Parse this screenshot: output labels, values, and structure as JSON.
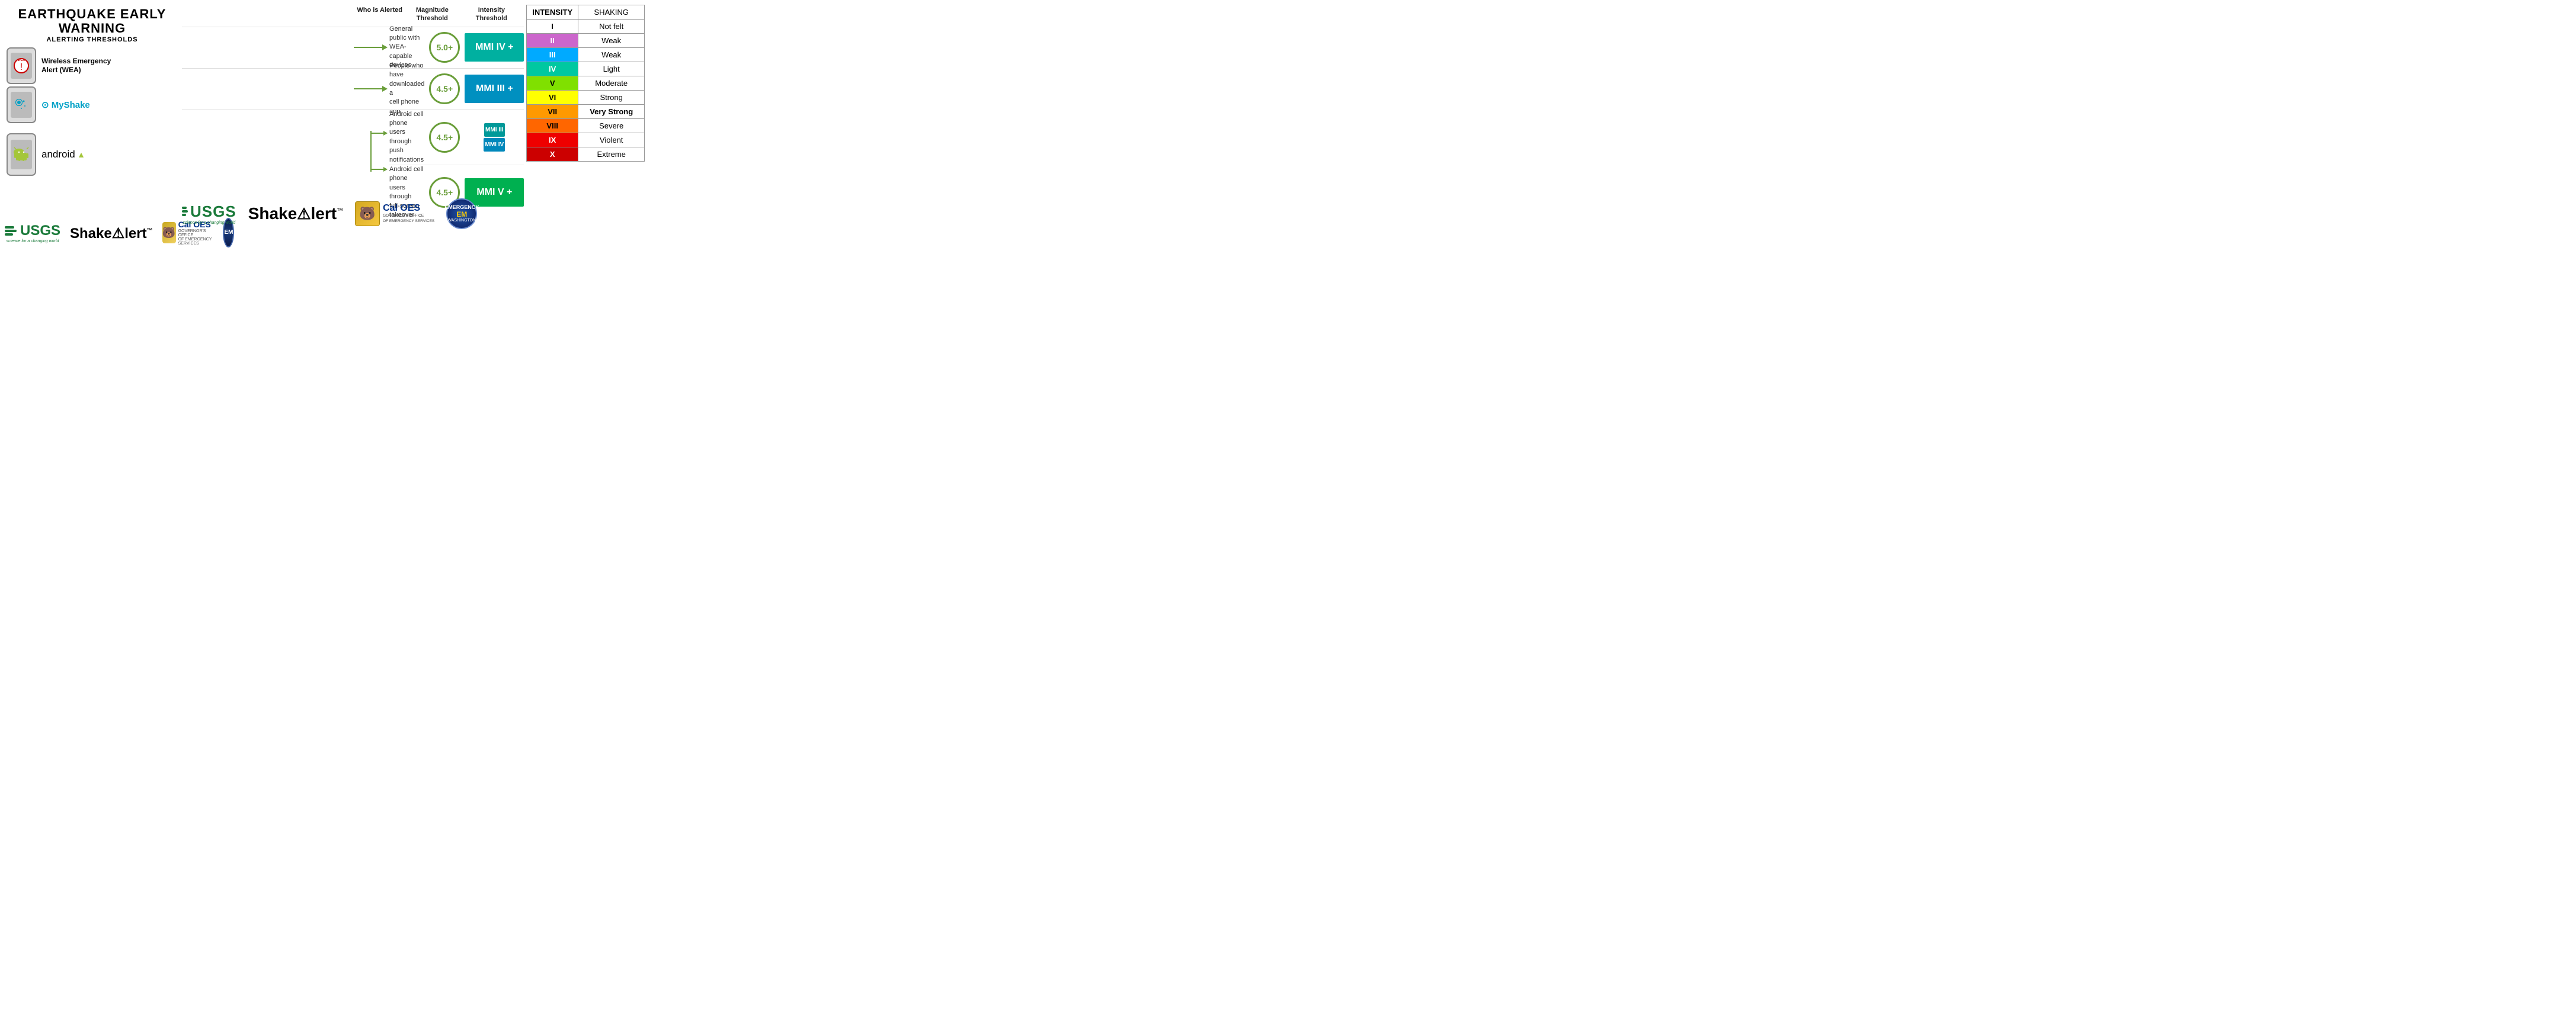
{
  "title": {
    "main": "EARTHQUAKE EARLY WARNING",
    "sub": "ALERTING THRESHOLDS"
  },
  "columns": {
    "who": "Who is Alerted",
    "magnitude": "Magnitude\nThreshold",
    "intensity": "Intensity\nThreshold"
  },
  "alerts": [
    {
      "id": "wea",
      "label": "Wireless Emergency\nAlert (WEA)",
      "who": "General public with WEA-capable devices",
      "magnitude": "5.0+",
      "intensity": "MMI IV +",
      "intensity_color": "teal"
    },
    {
      "id": "myshake",
      "label": "MyShake",
      "who": "People who have downloaded a cell phone app",
      "magnitude": "4.5+",
      "intensity": "MMI III +",
      "intensity_color": "blue"
    },
    {
      "id": "android",
      "label": "android",
      "rows": [
        {
          "who": "Android cell phone users through push notifications",
          "magnitude": "4.5+",
          "intensity_top": "MMI III",
          "intensity_bottom": "MMI IV",
          "intensity_type": "split"
        },
        {
          "who": "Android cell phone users through full-screen takeover",
          "magnitude": "4.5+",
          "intensity": "MMI V +",
          "intensity_color": "green"
        }
      ]
    }
  ],
  "table": {
    "headers": [
      "INTENSITY",
      "SHAKING"
    ],
    "rows": [
      {
        "intensity": "I",
        "shaking": "Not felt",
        "bg": "white"
      },
      {
        "intensity": "II",
        "shaking": "Weak",
        "bg": "purple"
      },
      {
        "intensity": "III",
        "shaking": "Weak",
        "bg": "blue"
      },
      {
        "intensity": "IV",
        "shaking": "Light",
        "bg": "teal"
      },
      {
        "intensity": "V",
        "shaking": "Moderate",
        "bg": "lgreen"
      },
      {
        "intensity": "VI",
        "shaking": "Strong",
        "bg": "yellow"
      },
      {
        "intensity": "VII",
        "shaking": "Very Strong",
        "bg": "orange"
      },
      {
        "intensity": "VIII",
        "shaking": "Severe",
        "bg": "darkorange"
      },
      {
        "intensity": "IX",
        "shaking": "Violent",
        "bg": "red"
      },
      {
        "intensity": "X",
        "shaking": "Extreme",
        "bg": "darkred"
      }
    ]
  },
  "logos": {
    "usgs": "≡USGS",
    "usgs_sub": "science for a changing world",
    "shakealert": "ShakeAlert",
    "tm": "™",
    "caloes": "Cal OES",
    "caloes_gov": "GOVERNOR'S OFFICE\nOF EMERGENCY SERVICES",
    "em": "EM"
  },
  "colors": {
    "teal": "#009999",
    "blue": "#0088bb",
    "green": "#22aa44",
    "arrow": "#6a9e3a",
    "usgs_green": "#1a7a3a"
  }
}
